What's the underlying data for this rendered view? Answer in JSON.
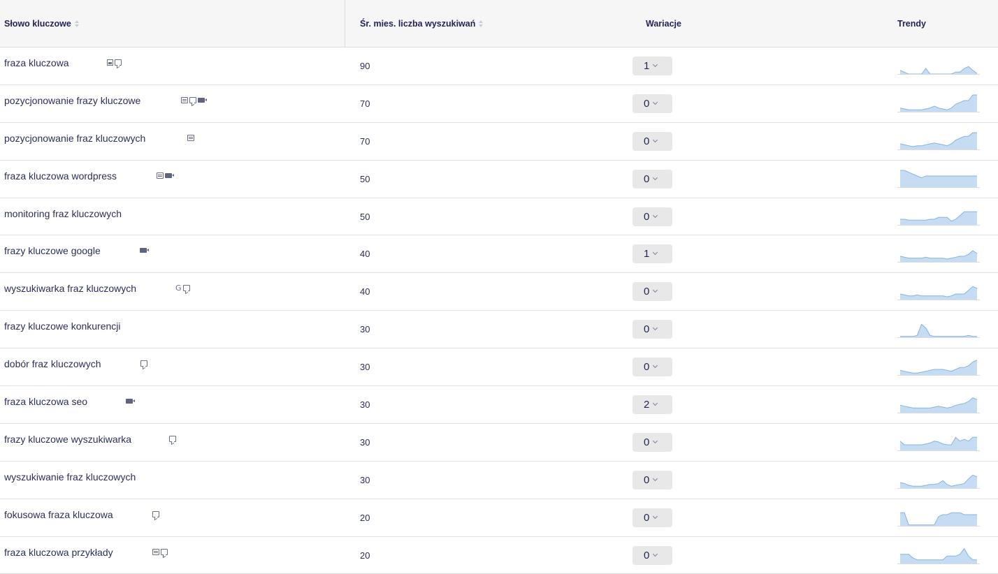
{
  "header": {
    "keyword": "Słowo kluczowe",
    "volume": "Śr. mies. liczba wyszukiwań",
    "variations": "Wariacje",
    "trends": "Trendy"
  },
  "colors": {
    "trend_fill": "#c5dcf3",
    "trend_line": "#86b4e2",
    "header_bg": "#f6f6f6"
  },
  "rows": [
    {
      "keyword": "fraza kluczowa",
      "volume": "90",
      "variations": "1",
      "features": [
        "image-icon",
        "comment-icon"
      ],
      "trend": [
        2,
        1,
        0,
        0,
        0,
        0,
        3,
        0,
        0,
        0,
        0,
        0,
        0,
        1,
        1,
        3,
        4,
        2,
        0.3
      ]
    },
    {
      "keyword": "pozycjonowanie frazy kluczowe",
      "volume": "70",
      "variations": "0",
      "features": [
        "snippet-icon",
        "comment-icon",
        "video-icon"
      ],
      "trend": [
        2,
        1.5,
        1,
        1,
        1,
        1,
        1.5,
        2,
        3,
        2,
        1.5,
        1,
        2,
        4,
        5,
        6,
        6,
        9,
        9
      ]
    },
    {
      "keyword": "pozycjonowanie fraz kluczowych",
      "volume": "70",
      "variations": "0",
      "features": [
        "snippet-icon"
      ],
      "trend": [
        3,
        2.5,
        2,
        1.5,
        2,
        2,
        2.5,
        3,
        3.5,
        3,
        2.5,
        2,
        3,
        5,
        6,
        7,
        7,
        9,
        9
      ]
    },
    {
      "keyword": "fraza kluczowa wordpress",
      "volume": "50",
      "variations": "0",
      "features": [
        "snippet-icon",
        "video-icon"
      ],
      "trend": [
        9,
        9,
        8,
        7,
        6,
        5,
        6,
        6,
        6,
        6,
        6,
        6,
        6,
        6,
        6,
        6,
        6,
        6,
        6
      ]
    },
    {
      "keyword": "monitoring fraz kluczowych",
      "volume": "50",
      "variations": "0",
      "features": [],
      "trend": [
        3,
        3,
        2.5,
        2.5,
        2.5,
        2.5,
        2.5,
        3,
        3,
        4,
        4,
        4,
        2,
        3,
        5,
        7,
        7,
        7,
        7
      ]
    },
    {
      "keyword": "frazy kluczowe google",
      "volume": "40",
      "variations": "1",
      "features": [
        "video-icon"
      ],
      "trend": [
        3,
        2.5,
        2,
        2,
        2,
        2,
        2.5,
        2,
        2,
        2,
        2,
        1.5,
        2,
        2.5,
        3,
        3,
        4,
        6,
        4.5
      ]
    },
    {
      "keyword": "wyszukiwarka fraz kluczowych",
      "volume": "40",
      "variations": "0",
      "features": [
        "g-icon",
        "comment-icon"
      ],
      "trend": [
        3,
        2.5,
        2,
        2,
        2.5,
        2,
        2,
        2,
        2,
        2,
        2,
        1.5,
        2,
        3,
        3,
        3,
        5,
        7,
        6
      ]
    },
    {
      "keyword": "frazy kluczowe konkurencji",
      "volume": "30",
      "variations": "0",
      "features": [],
      "trend": [
        0.5,
        0.5,
        0.5,
        0.5,
        1,
        7,
        5,
        1,
        0.5,
        0.5,
        0.5,
        0.5,
        0.5,
        0.5,
        0.5,
        0.5,
        1,
        0.5,
        0.5
      ]
    },
    {
      "keyword": "dobór fraz kluczowych",
      "volume": "30",
      "variations": "0",
      "features": [
        "comment-icon"
      ],
      "trend": [
        2.5,
        2,
        1.5,
        1,
        1,
        1.5,
        2,
        2.5,
        3,
        3,
        3,
        2.5,
        2,
        3,
        4,
        4,
        5,
        7,
        8
      ]
    },
    {
      "keyword": "fraza kluczowa seo",
      "volume": "30",
      "variations": "2",
      "features": [
        "video-icon"
      ],
      "trend": [
        4,
        3.5,
        3,
        2.5,
        2.5,
        2.5,
        2.5,
        2.5,
        3,
        3.5,
        3,
        2.5,
        3,
        4,
        4.5,
        5,
        6,
        8,
        7
      ]
    },
    {
      "keyword": "frazy kluczowe wyszukiwarka",
      "volume": "30",
      "variations": "0",
      "features": [
        "comment-icon"
      ],
      "trend": [
        5,
        3,
        3,
        3,
        3,
        3,
        3.5,
        4,
        5,
        4.5,
        3.5,
        3,
        3,
        7,
        5,
        6,
        5,
        7,
        7
      ]
    },
    {
      "keyword": "wyszukiwanie fraz kluczowych",
      "volume": "30",
      "variations": "0",
      "features": [],
      "trend": [
        3,
        2.5,
        1.5,
        1,
        1,
        1,
        1.5,
        2,
        2,
        2.5,
        4,
        2,
        1,
        1.5,
        2,
        2.5,
        5,
        7,
        6
      ]
    },
    {
      "keyword": "fokusowa fraza kluczowa",
      "volume": "20",
      "variations": "0",
      "features": [
        "comment-icon"
      ],
      "trend": [
        7,
        7,
        0.5,
        0.5,
        0.5,
        0.5,
        0.5,
        0.5,
        0.5,
        5,
        6,
        6,
        7,
        7,
        7,
        6,
        6,
        6,
        6
      ]
    },
    {
      "keyword": "fraza kluczowa przykłady",
      "volume": "20",
      "variations": "0",
      "features": [
        "snippet-icon",
        "comment-icon"
      ],
      "trend": [
        5,
        5,
        5,
        3,
        2,
        2,
        2,
        2,
        2,
        2,
        2,
        4,
        4,
        4,
        5,
        8,
        4,
        2,
        2
      ]
    }
  ]
}
